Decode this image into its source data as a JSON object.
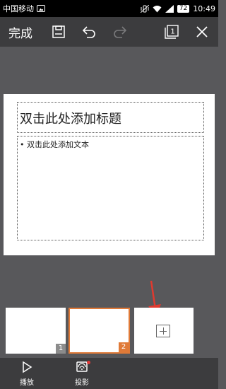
{
  "status_bar": {
    "carrier": "中国移动",
    "battery": "72",
    "time": "10:49"
  },
  "toolbar": {
    "done_label": "完成",
    "slide_count_badge": "1"
  },
  "slide": {
    "title_placeholder": "双击此处添加标题",
    "body_placeholder": "• 双击此处添加文本"
  },
  "thumbnails": [
    {
      "number": "1",
      "selected": false
    },
    {
      "number": "2",
      "selected": true
    }
  ],
  "bottom_bar": {
    "play_label": "播放",
    "project_label": "投影"
  },
  "colors": {
    "accent": "#e07a38",
    "toolbar_bg": "#3c3c3e",
    "canvas_bg": "#58585b",
    "annotation_arrow": "#e03a2f"
  },
  "icons": {
    "save": "save-icon",
    "undo": "undo-icon",
    "redo": "redo-icon",
    "slides": "slides-icon",
    "close": "close-icon",
    "add_slide": "add-slide-icon",
    "play": "play-icon",
    "project": "project-icon"
  }
}
